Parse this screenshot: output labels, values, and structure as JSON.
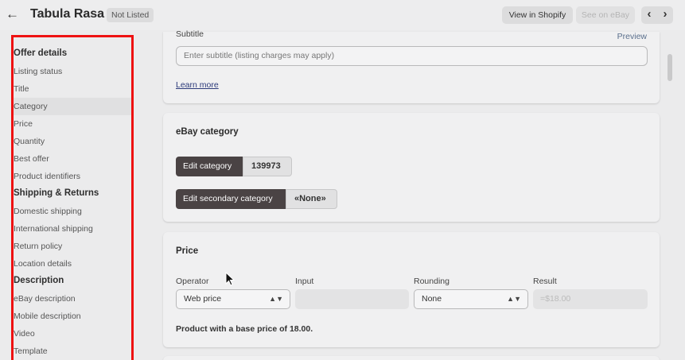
{
  "header": {
    "title": "Tabula Rasa",
    "badge": "Not Listed",
    "view_in_shopify": "View in Shopify",
    "see_on_ebay": "See on eBay",
    "prev_glyph": "‹",
    "next_glyph": "›",
    "back_glyph": "←"
  },
  "sidebar": {
    "sections": [
      {
        "title": "Offer details",
        "items": [
          "Listing status",
          "Title",
          "Category",
          "Price",
          "Quantity",
          "Best offer",
          "Product identifiers"
        ]
      },
      {
        "title": "Shipping & Returns",
        "items": [
          "Domestic shipping",
          "International shipping",
          "Return policy",
          "Location details"
        ]
      },
      {
        "title": "Description",
        "items": [
          "eBay description",
          "Mobile description",
          "Video",
          "Template"
        ]
      }
    ],
    "active_item": "Category"
  },
  "subtitle_card": {
    "label": "Subtitle",
    "preview": "Preview",
    "placeholder": "Enter subtitle (listing charges may apply)",
    "learn_more": "Learn more"
  },
  "category_card": {
    "title": "eBay category",
    "edit_category": "Edit category",
    "category_id": "139973",
    "edit_secondary": "Edit secondary category",
    "secondary_value": "«None»"
  },
  "price_card": {
    "title": "Price",
    "operator_label": "Operator",
    "operator_value": "Web price",
    "input_label": "Input",
    "rounding_label": "Rounding",
    "rounding_value": "None",
    "result_label": "Result",
    "result_value": "=$18.00",
    "note": "Product with a base price of 18.00."
  },
  "icons": {
    "back": "arrow-left-icon",
    "select": "chevron-updown-icon",
    "cursor": "mouse-pointer-icon"
  }
}
